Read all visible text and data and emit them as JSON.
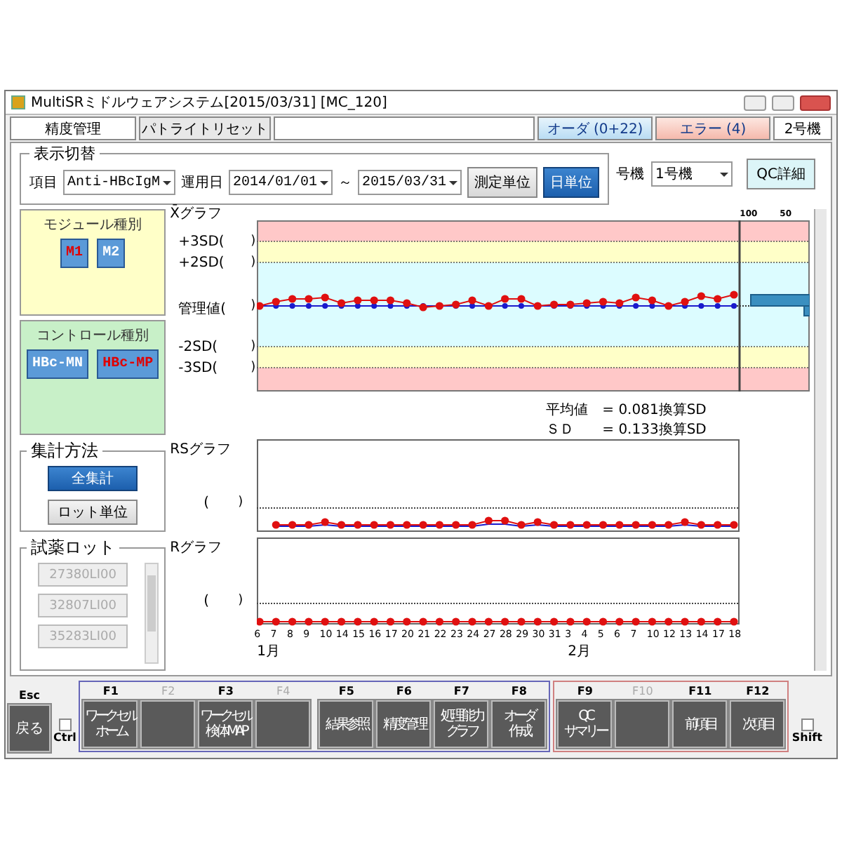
{
  "window": {
    "title": "MultiSRミドルウェアシステム[2015/03/31] [MC_120]"
  },
  "header": {
    "tabs": [
      {
        "label": "精度管理",
        "selected": true
      }
    ],
    "patlight_button": "パトライトリセット",
    "order_button": "オーダ (0+22)",
    "error_button": "エラー (4)",
    "unit": "2号機"
  },
  "display_switch": {
    "title": "表示切替",
    "item_label": "項目",
    "item_value": "Anti-HBcIgM",
    "date_label": "運用日",
    "date_from": "2014/01/01",
    "tilde": "～",
    "date_to": "2015/03/31",
    "unit_buttons": [
      {
        "label": "測定単位",
        "selected": false
      },
      {
        "label": "日単位",
        "selected": true
      }
    ],
    "machine_label": "号機",
    "machine_value": "1号機",
    "qc_button": "QC詳細"
  },
  "modules": {
    "title": "モジュール種別",
    "items": [
      {
        "label": "M1",
        "selected": true
      },
      {
        "label": "M2",
        "selected": false
      }
    ]
  },
  "controls": {
    "title": "コントロール種別",
    "items": [
      {
        "label": "HBc-MN",
        "selected": false
      },
      {
        "label": "HBc-MP",
        "selected": true
      }
    ]
  },
  "aggregation": {
    "title": "集計方法",
    "options": [
      {
        "label": "全集計",
        "selected": true
      },
      {
        "label": "ロット単位",
        "selected": false
      }
    ]
  },
  "reagent_lots": {
    "title": "試薬ロット",
    "items": [
      {
        "label": "27380LI00",
        "disabled": true
      },
      {
        "label": "32807LI00",
        "disabled": true
      },
      {
        "label": "35283LI00",
        "disabled": true
      }
    ]
  },
  "x_chart": {
    "title": "X̄グラフ",
    "limits": [
      {
        "label": "+3SD(",
        "close": ")"
      },
      {
        "label": "+2SD(",
        "close": ")"
      },
      {
        "label": "管理値(",
        "close": ")"
      },
      {
        "label": "-2SD(",
        "close": ")"
      },
      {
        "label": "-3SD(",
        "close": ")"
      }
    ],
    "histogram_scale": [
      "100",
      "50"
    ],
    "stats": [
      "平均値　= 0.081換算SD",
      "ＳＤ　　= 0.133換算SD"
    ]
  },
  "rs_chart": {
    "title": "RSグラフ",
    "limit": {
      "label": "(",
      "close": ")"
    }
  },
  "r_chart": {
    "title": "Rグラフ",
    "limit": {
      "label": "(",
      "close": ")"
    },
    "x_labels": [
      "6",
      "7",
      "8",
      "9",
      "10",
      "14",
      "15",
      "16",
      "17",
      "20",
      "21",
      "22",
      "23",
      "24",
      "27",
      "28",
      "29",
      "30",
      "31",
      "3",
      "4",
      "5",
      "6",
      "7",
      "10",
      "12",
      "13",
      "14",
      "17",
      "18"
    ],
    "months": [
      "1月",
      "2月"
    ]
  },
  "function_bar": {
    "esc": {
      "key": "Esc",
      "label": "戻る"
    },
    "ctrl": {
      "label": "Ctrl",
      "checked": false
    },
    "shift": {
      "label": "Shift",
      "checked": false
    },
    "groups": [
      {
        "keys": [
          {
            "key": "F1",
            "lines": [
              "ワークセル",
              "ホーム"
            ],
            "enabled": true
          },
          {
            "key": "F2",
            "enabled": false
          },
          {
            "key": "F3",
            "lines": [
              "ワークセル",
              "検体MAP"
            ],
            "enabled": true
          },
          {
            "key": "F4",
            "enabled": false
          },
          {
            "key": "F5",
            "lines": [
              "結果参照"
            ],
            "enabled": true
          },
          {
            "key": "F6",
            "lines": [
              "精度管理"
            ],
            "enabled": true
          },
          {
            "key": "F7",
            "lines": [
              "処理能力",
              "グラフ"
            ],
            "enabled": true
          },
          {
            "key": "F8",
            "lines": [
              "オーダ",
              "作成"
            ],
            "enabled": true
          }
        ]
      },
      {
        "keys": [
          {
            "key": "F9",
            "lines": [
              "QC",
              "サマリー"
            ],
            "enabled": true
          },
          {
            "key": "F10",
            "enabled": false
          },
          {
            "key": "F11",
            "lines": [
              "前項目"
            ],
            "enabled": true
          },
          {
            "key": "F12",
            "lines": [
              "次項目"
            ],
            "enabled": true
          }
        ]
      }
    ]
  }
}
